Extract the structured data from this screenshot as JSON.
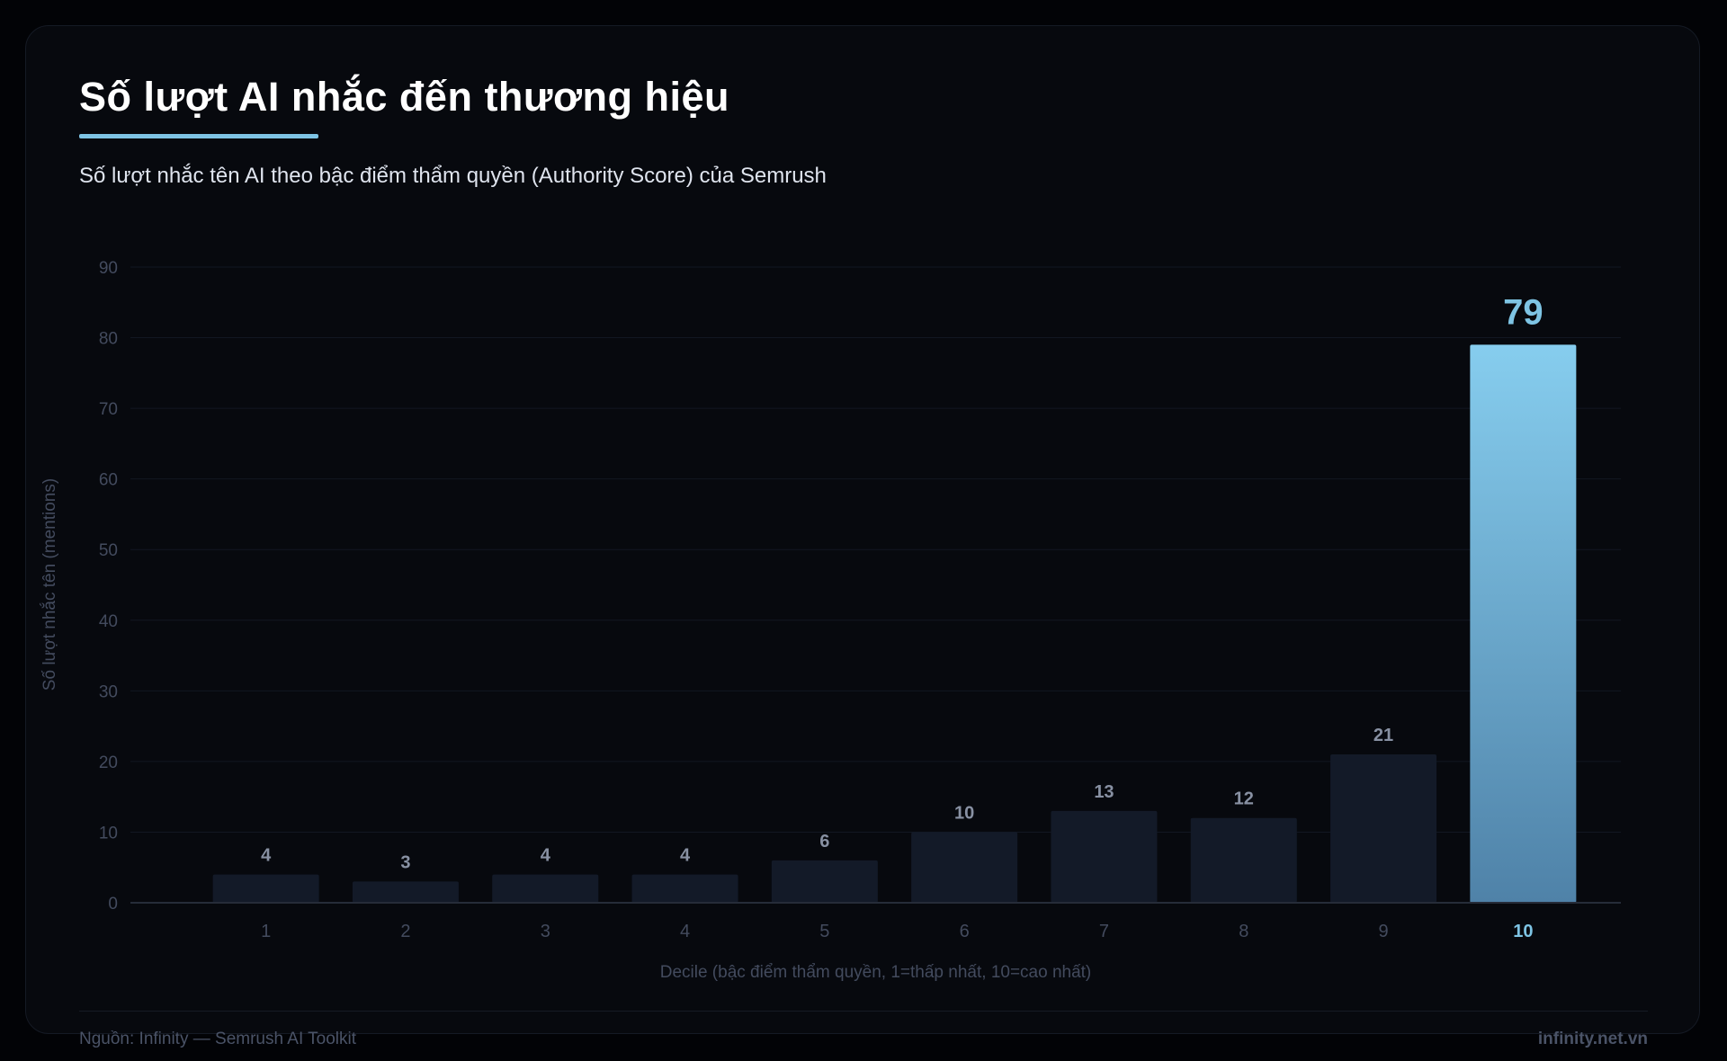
{
  "header": {
    "title": "Số lượt AI nhắc đến thương hiệu",
    "subtitle": "Số lượt nhắc tên AI theo bậc điểm thẩm quyền (Authority Score) của Semrush"
  },
  "footer": {
    "source": "Nguồn: Infinity — Semrush AI Toolkit",
    "site": "infinity.net.vn"
  },
  "colors": {
    "background": "#07090e",
    "bar": "#131a28",
    "highlight_top": "#86cdee",
    "highlight_bottom": "#4f82a8",
    "accent": "#7ec4e4",
    "grid": "#121722",
    "tick_text": "#434b5e",
    "value_label": "#8891a3"
  },
  "chart_data": {
    "type": "bar",
    "title": "Số lượt AI nhắc đến thương hiệu",
    "subtitle": "Số lượt nhắc tên AI theo bậc điểm thẩm quyền (Authority Score) của Semrush",
    "xlabel": "Decile (bậc điểm thẩm quyền, 1=thấp nhất, 10=cao nhất)",
    "ylabel": "Số lượt nhắc tên (mentions)",
    "categories": [
      "1",
      "2",
      "3",
      "4",
      "5",
      "6",
      "7",
      "8",
      "9",
      "10"
    ],
    "values": [
      4,
      3,
      4,
      4,
      6,
      10,
      13,
      12,
      21,
      79
    ],
    "highlight_category": "10",
    "ylim": [
      0,
      90
    ],
    "yticks": [
      0,
      10,
      20,
      30,
      40,
      50,
      60,
      70,
      80,
      90
    ],
    "grid": true,
    "data_labels": true
  }
}
